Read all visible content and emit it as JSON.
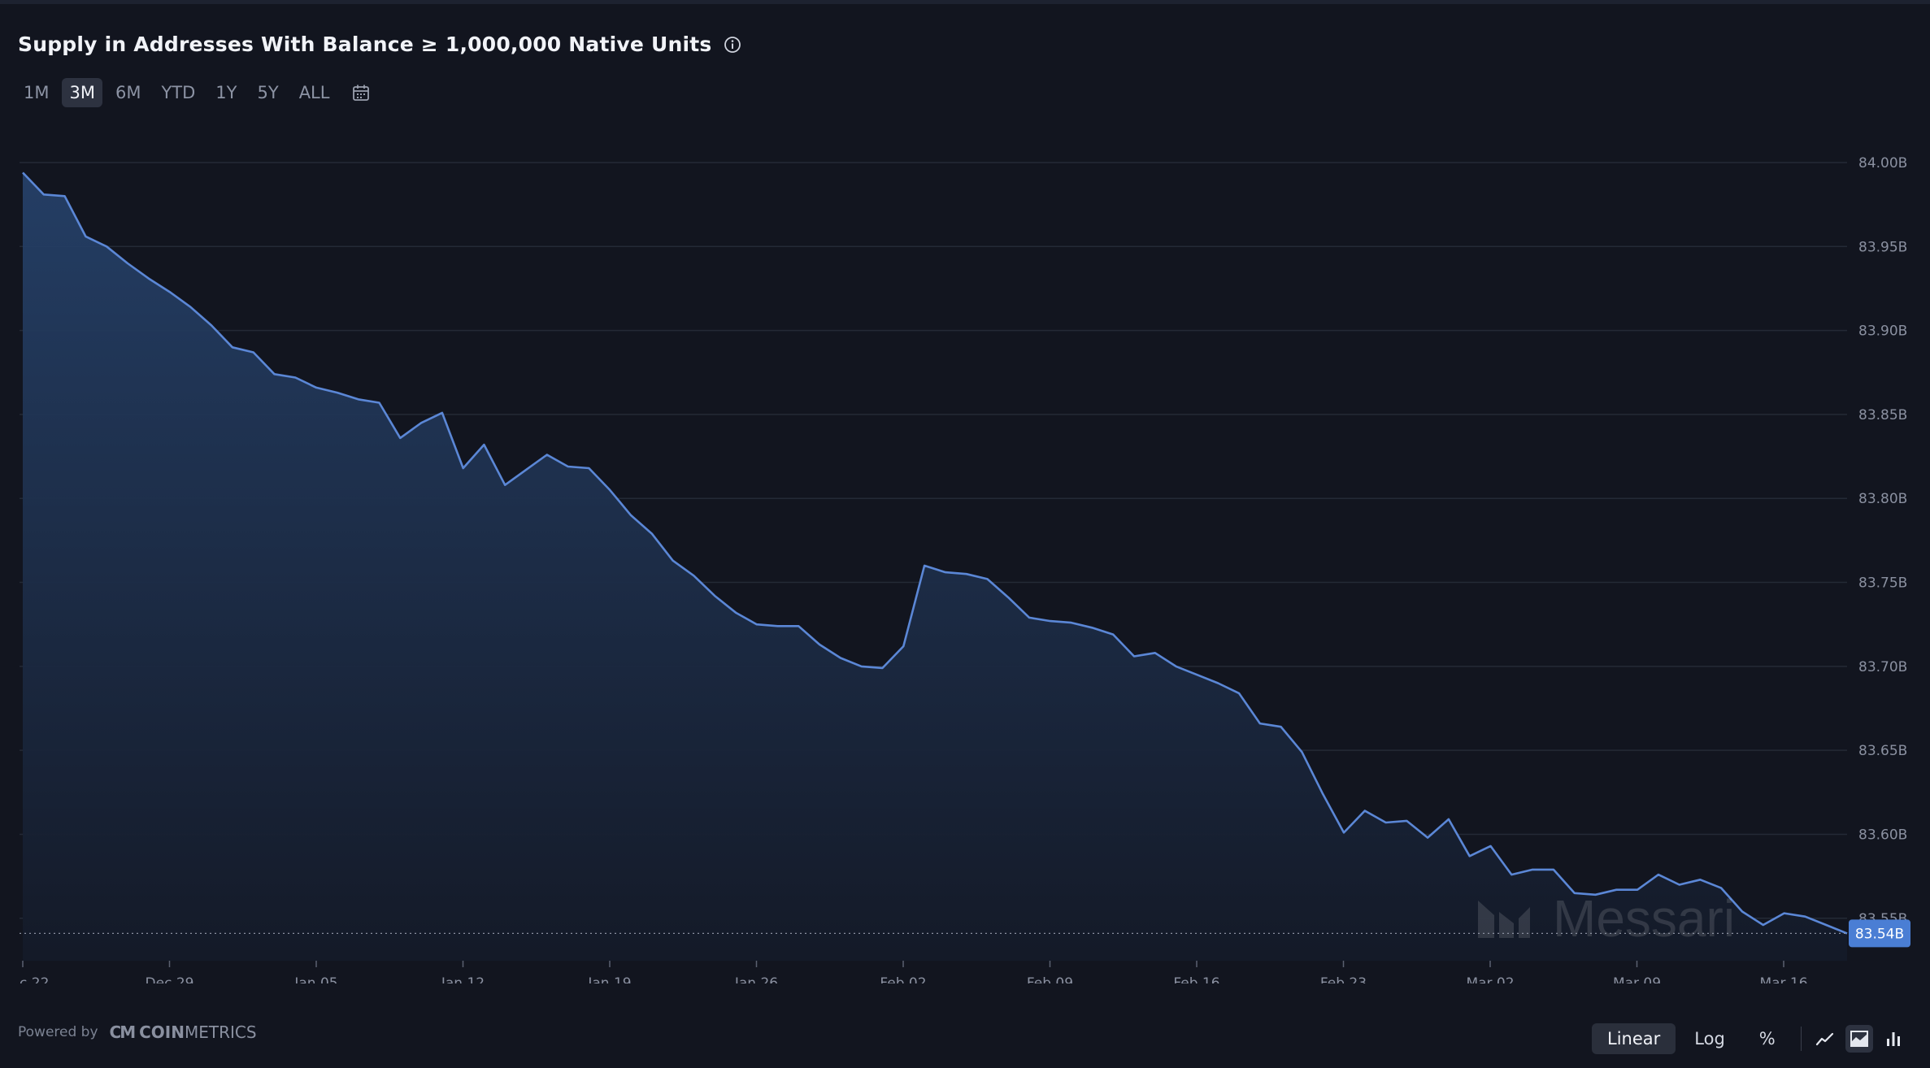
{
  "header": {
    "title": "Supply in Addresses With Balance ≥ 1,000,000 Native Units",
    "info_icon": "info-icon"
  },
  "time_ranges": [
    "1M",
    "3M",
    "6M",
    "YTD",
    "1Y",
    "5Y",
    "ALL"
  ],
  "active_range": "3M",
  "calendar_icon": "calendar-icon",
  "footer": {
    "powered_by": "Powered by",
    "logo_mark": "CM",
    "logo_word_bold": "COIN",
    "logo_word_light": "METRICS"
  },
  "scale_options": [
    "Linear",
    "Log",
    "%"
  ],
  "active_scale": "Linear",
  "chart_types": [
    "line-chart-icon",
    "area-chart-icon",
    "bar-chart-icon"
  ],
  "active_chart_type": "area-chart-icon",
  "watermark": "Messari",
  "colors": {
    "background": "#12151f",
    "line": "#5b87d6",
    "fill_top": "#254068",
    "fill_bottom": "#141a28",
    "grid": "#242a36",
    "axis_text": "#8a90a0",
    "current_badge": "#4a7ed4"
  },
  "chart_data": {
    "type": "area",
    "title": "Supply in Addresses With Balance ≥ 1,000,000 Native Units",
    "xlabel": "",
    "ylabel": "",
    "x_start": "2023-12-22",
    "x_tick_labels": [
      "c 22",
      "Dec 29",
      "Jan 05",
      "Jan 12",
      "Jan 19",
      "Jan 26",
      "Feb 02",
      "Feb 09",
      "Feb 16",
      "Feb 23",
      "Mar 02",
      "Mar 09",
      "Mar 16"
    ],
    "y_tick_labels": [
      "84.00B",
      "83.95B",
      "83.90B",
      "83.85B",
      "83.80B",
      "83.75B",
      "83.70B",
      "83.65B",
      "83.60B",
      "83.55B"
    ],
    "y_ticks": [
      84.0,
      83.95,
      83.9,
      83.85,
      83.8,
      83.75,
      83.7,
      83.65,
      83.6,
      83.55
    ],
    "ylim": [
      83.5315,
      84.0
    ],
    "y_unit": "B",
    "grid": true,
    "current_value_label": "83.54B",
    "current_value": 83.541,
    "series": [
      {
        "values": [
          83.994,
          83.981,
          83.98,
          83.956,
          83.95,
          83.94,
          83.931,
          83.923,
          83.914,
          83.903,
          83.89,
          83.887,
          83.874,
          83.872,
          83.866,
          83.863,
          83.859,
          83.857,
          83.836,
          83.845,
          83.851,
          83.818,
          83.832,
          83.808,
          83.817,
          83.826,
          83.819,
          83.818,
          83.805,
          83.79,
          83.779,
          83.763,
          83.754,
          83.742,
          83.732,
          83.725,
          83.724,
          83.724,
          83.713,
          83.705,
          83.7,
          83.699,
          83.712,
          83.76,
          83.756,
          83.755,
          83.752,
          83.741,
          83.729,
          83.727,
          83.726,
          83.723,
          83.719,
          83.706,
          83.708,
          83.7,
          83.695,
          83.69,
          83.684,
          83.666,
          83.664,
          83.649,
          83.624,
          83.601,
          83.614,
          83.607,
          83.608,
          83.598,
          83.609,
          83.587,
          83.593,
          83.576,
          83.579,
          83.579,
          83.565,
          83.564,
          83.567,
          83.567,
          83.576,
          83.57,
          83.573,
          83.568,
          83.554,
          83.546,
          83.553,
          83.551,
          83.546,
          83.541
        ]
      }
    ]
  }
}
